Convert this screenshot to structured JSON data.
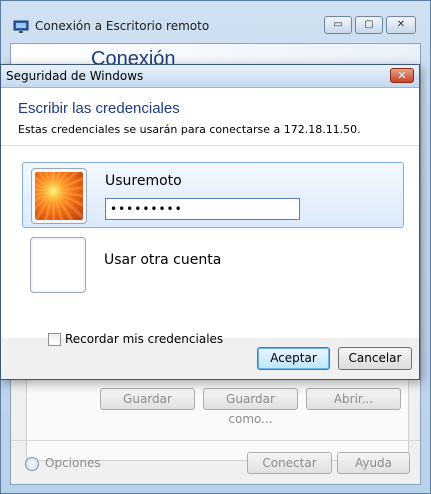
{
  "background_window": {
    "title": "Conexión a Escritorio remoto",
    "banner_text": "Conexión",
    "caption_buttons": {
      "minimize": "▭",
      "maximize": "▢",
      "close": "✕"
    },
    "profile_buttons": [
      "Guardar",
      "Guardar como...",
      "Abrir..."
    ],
    "options_label": "Opciones",
    "connect_label": "Conectar",
    "help_label": "Ayuda",
    "icon": "remote-desktop-icon"
  },
  "dialog": {
    "title": "Seguridad de Windows",
    "close_symbol": "✕",
    "heading": "Escribir las credenciales",
    "subtitle": "Estas credenciales se usarán para conectarse a 172.18.11.50.",
    "accounts": [
      {
        "label": "Usuremoto",
        "password_value": "•••••••••",
        "selected": true
      },
      {
        "label": "Usar otra cuenta",
        "selected": false
      }
    ],
    "remember_label": "Recordar mis credenciales",
    "remember_checked": false,
    "accept_label": "Aceptar",
    "cancel_label": "Cancelar"
  }
}
